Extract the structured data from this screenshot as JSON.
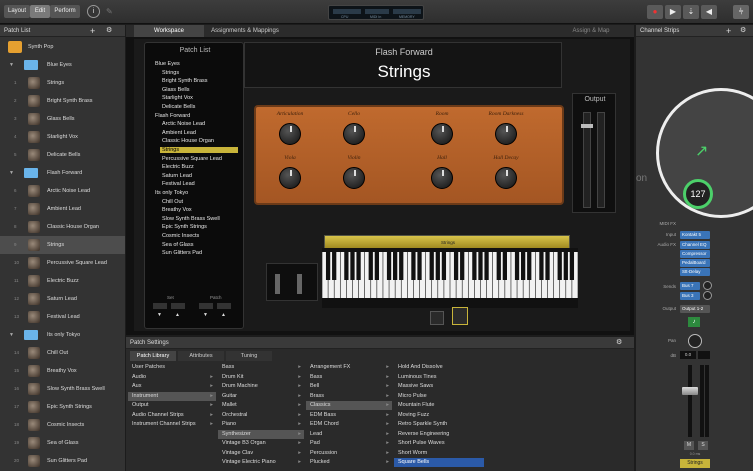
{
  "toolbar": {
    "layout": "Layout",
    "edit": "Edit",
    "perform": "Perform",
    "info_icon": "i",
    "cpu": "CPU",
    "midi": "MIDI In",
    "memory": "MEMORY"
  },
  "left_pane": {
    "title": "Patch List",
    "top_item": "Synth Pop",
    "rows": [
      {
        "num": "",
        "name": "Blue Eyes",
        "type": "folder"
      },
      {
        "num": "1",
        "name": "Strings"
      },
      {
        "num": "2",
        "name": "Bright Synth Brass"
      },
      {
        "num": "3",
        "name": "Glass Bells"
      },
      {
        "num": "4",
        "name": "Starlight Vox"
      },
      {
        "num": "5",
        "name": "Delicate Bells"
      },
      {
        "num": "",
        "name": "Flash Forward",
        "type": "folder"
      },
      {
        "num": "6",
        "name": "Arctic Noise Lead"
      },
      {
        "num": "7",
        "name": "Ambient Lead"
      },
      {
        "num": "8",
        "name": "Classic House Organ"
      },
      {
        "num": "9",
        "name": "Strings",
        "selected": true
      },
      {
        "num": "10",
        "name": "Percussive Square Lead"
      },
      {
        "num": "11",
        "name": "Electric Buzz"
      },
      {
        "num": "12",
        "name": "Saturn Lead"
      },
      {
        "num": "13",
        "name": "Festival Lead"
      },
      {
        "num": "",
        "name": "Its only Tokyo",
        "type": "folder"
      },
      {
        "num": "14",
        "name": "Chill Out"
      },
      {
        "num": "15",
        "name": "Breathy Vox"
      },
      {
        "num": "16",
        "name": "Slow Synth Brass Swell"
      },
      {
        "num": "17",
        "name": "Epic Synth Strings"
      },
      {
        "num": "18",
        "name": "Cosmic Insects"
      },
      {
        "num": "19",
        "name": "Sea of Glass"
      },
      {
        "num": "20",
        "name": "Sun Glitters Pad"
      }
    ]
  },
  "center": {
    "tab_workspace": "Workspace",
    "tab_assign": "Assignments & Mappings",
    "assign_map": "Assign & Map",
    "patch_list_title": "Patch List",
    "list": [
      {
        "t": "cat",
        "v": "Blue Eyes"
      },
      {
        "t": "item",
        "v": "Strings"
      },
      {
        "t": "item",
        "v": "Bright Synth Brass"
      },
      {
        "t": "item",
        "v": "Glass Bells"
      },
      {
        "t": "item",
        "v": "Starlight Vox"
      },
      {
        "t": "item",
        "v": "Delicate Bells"
      },
      {
        "t": "cat",
        "v": "Flash Forward"
      },
      {
        "t": "item",
        "v": "Arctic Noise Lead"
      },
      {
        "t": "item",
        "v": "Ambient Lead"
      },
      {
        "t": "item",
        "v": "Classic House Organ"
      },
      {
        "t": "sel",
        "v": "Strings"
      },
      {
        "t": "item",
        "v": "Percussive Square Lead"
      },
      {
        "t": "item",
        "v": "Electric Buzz"
      },
      {
        "t": "item",
        "v": "Saturn Lead"
      },
      {
        "t": "item",
        "v": "Festival Lead"
      },
      {
        "t": "cat",
        "v": "Its only Tokyo"
      },
      {
        "t": "item",
        "v": "Chill Out"
      },
      {
        "t": "item",
        "v": "Breathy Vox"
      },
      {
        "t": "item",
        "v": "Slow Synth Brass Swell"
      },
      {
        "t": "item",
        "v": "Epic Synth Strings"
      },
      {
        "t": "item",
        "v": "Cosmic Insects"
      },
      {
        "t": "item",
        "v": "Sea of Glass"
      },
      {
        "t": "item",
        "v": "Sun Glitters Pad"
      }
    ],
    "set_label": "Set",
    "patch_label": "Patch",
    "song": "Flash Forward",
    "patch": "Strings",
    "knobs_top": [
      "Articulation",
      "Cello",
      "Room",
      "Room Darkness"
    ],
    "knobs_bottom": [
      "Viola",
      "Violin",
      "Hall",
      "Hall Decay"
    ],
    "output": "Output",
    "strip_label": "Strings"
  },
  "right_pane": {
    "title": "Channel Strips",
    "value": "127",
    "partial": "on",
    "midi_fx": "MIDI FX",
    "input_lbl": "Input",
    "input": "Kontakt 5",
    "audio_fx_lbl": "Audio FX",
    "audio_fx": [
      "Channel EQ",
      "Compressor",
      "PedalBoard",
      "Stt-Delay"
    ],
    "sends_lbl": "Sends",
    "sends": [
      "Bus 7",
      "Bus 3"
    ],
    "output_lbl": "Output",
    "output": "Output 1-2",
    "pan_lbl": "Pan",
    "db_lbl": "dB",
    "db": "0.0",
    "mute": "M",
    "solo": "S",
    "meter_label": "0.0 ms",
    "name": "Strings"
  },
  "bottom": {
    "title": "Patch Settings",
    "tabs": [
      "Patch Library",
      "Attributes",
      "Tuning"
    ],
    "col1": [
      "User Patches",
      "Audio",
      "Aux",
      "Instrument",
      "Output",
      "Audio Channel Strips",
      "Instrument Channel Strips"
    ],
    "col2": [
      "Bass",
      "Drum Kit",
      "Drum Machine",
      "Guitar",
      "Mallet",
      "Orchestral",
      "Piano",
      "Synthesizer",
      "Vintage B3 Organ",
      "Vintage Clav",
      "Vintage Electric Piano"
    ],
    "col3": [
      "Arrangement FX",
      "Bass",
      "Bell",
      "Brass",
      "Classics",
      "EDM Bass",
      "EDM Chord",
      "Lead",
      "Pad",
      "Percussion",
      "Plucked"
    ],
    "col4": [
      "Hold And Dissolve",
      "Luminous Tines",
      "Massive Saws",
      "Micro Pulse",
      "Mountain Flute",
      "Moving Fuzz",
      "Retro Sparkle Synth",
      "Reverse Engineering",
      "Short Pulse Waves",
      "Short Worm",
      "Square Bells"
    ]
  }
}
